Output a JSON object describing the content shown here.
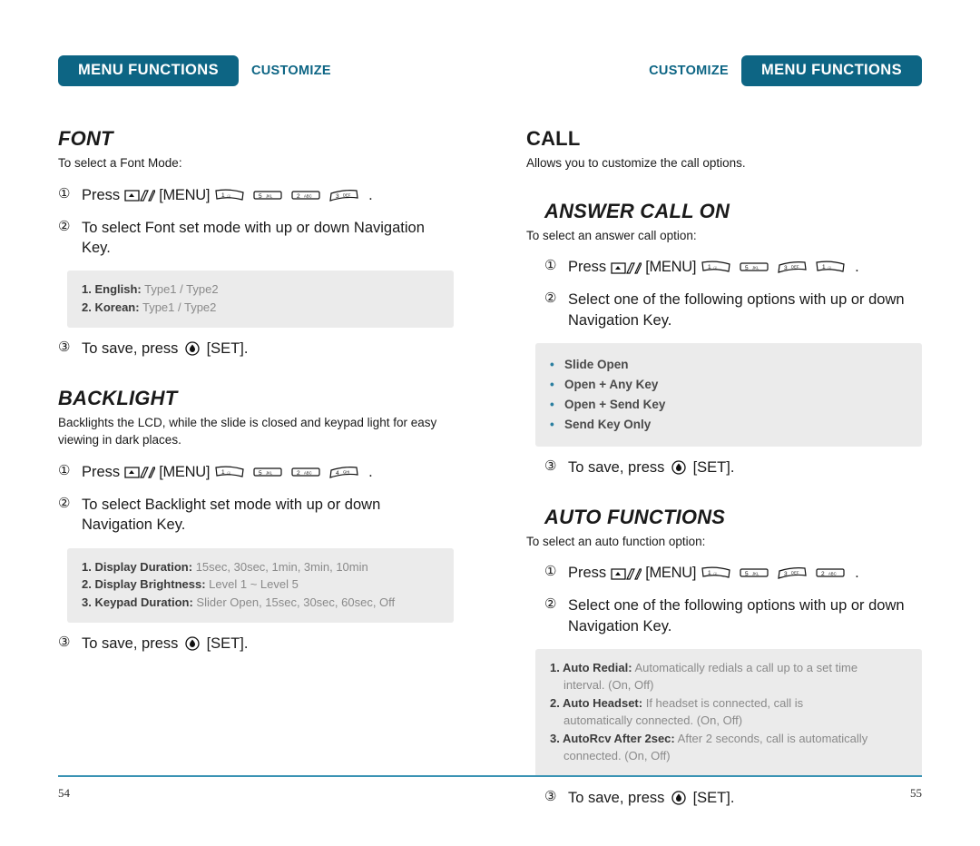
{
  "colors": {
    "banner_teal": "#0d6584",
    "rule_teal": "#3a93b4",
    "bullet_teal": "#2b7fa0",
    "infobox_bg": "#ebebeb"
  },
  "left_page": {
    "banner": "MENU FUNCTIONS",
    "section_tag": "CUSTOMIZE",
    "page_number": "54",
    "sections": [
      {
        "heading": "FONT",
        "lead": "To select a Font Mode:",
        "steps": [
          {
            "num": "①",
            "press_word": "Press",
            "menu_label": "[MENU]",
            "keys": [
              {
                "digit": "1",
                "letters": "☉",
                "shape": "slanted"
              },
              {
                "digit": "5",
                "letters": "JKL",
                "shape": "flat"
              },
              {
                "digit": "2",
                "letters": "ABC",
                "shape": "flat"
              },
              {
                "digit": "3",
                "letters": "DEF",
                "shape": "slanted"
              }
            ],
            "trailing": "."
          },
          {
            "num": "②",
            "text": "To select Font set mode with up or down Navigation Key."
          }
        ],
        "infobox": {
          "type": "numbered",
          "rows": [
            {
              "label": "1. English:",
              "value": "Type1 / Type2"
            },
            {
              "label": "2. Korean:",
              "value": "Type1 / Type2"
            }
          ]
        },
        "save_step": {
          "num": "③",
          "prefix": "To save, press",
          "suffix": "[SET]."
        }
      },
      {
        "heading": "BACKLIGHT",
        "lead": "Backlights the LCD, while the slide is closed and keypad light for easy viewing in dark places.",
        "steps": [
          {
            "num": "①",
            "press_word": "Press",
            "menu_label": "[MENU]",
            "keys": [
              {
                "digit": "1",
                "letters": "☉",
                "shape": "slanted"
              },
              {
                "digit": "5",
                "letters": "JKL",
                "shape": "flat"
              },
              {
                "digit": "2",
                "letters": "ABC",
                "shape": "flat"
              },
              {
                "digit": "4",
                "letters": "GHI",
                "shape": "slanted"
              }
            ],
            "trailing": "."
          },
          {
            "num": "②",
            "text": "To select Backlight set mode with up or down Navigation Key."
          }
        ],
        "infobox": {
          "type": "numbered",
          "rows": [
            {
              "label": "1. Display Duration:",
              "value": "15sec, 30sec, 1min, 3min, 10min"
            },
            {
              "label": "2. Display Brightness:",
              "value": "Level 1 ~ Level 5"
            },
            {
              "label": "3. Keypad Duration:",
              "value": "Slider Open, 15sec, 30sec, 60sec, Off"
            }
          ]
        },
        "save_step": {
          "num": "③",
          "prefix": "To save, press",
          "suffix": "[SET]."
        }
      }
    ]
  },
  "right_page": {
    "banner": "MENU FUNCTIONS",
    "section_tag": "CUSTOMIZE",
    "page_number": "55",
    "top_heading": "CALL",
    "top_lead": "Allows you to customize the call options.",
    "sections": [
      {
        "heading": "ANSWER CALL ON",
        "lead": "To select an answer call option:",
        "steps": [
          {
            "num": "①",
            "press_word": "Press",
            "menu_label": "[MENU]",
            "keys": [
              {
                "digit": "1",
                "letters": "☉",
                "shape": "slanted"
              },
              {
                "digit": "5",
                "letters": "JKL",
                "shape": "flat"
              },
              {
                "digit": "3",
                "letters": "DEF",
                "shape": "slanted"
              },
              {
                "digit": "1",
                "letters": "☉",
                "shape": "slanted"
              }
            ],
            "trailing": "."
          },
          {
            "num": "②",
            "text": "Select one of the following options with up or down Navigation Key."
          }
        ],
        "infobox": {
          "type": "bullets",
          "rows": [
            {
              "label": "Slide Open"
            },
            {
              "label": "Open + Any Key"
            },
            {
              "label": "Open + Send Key"
            },
            {
              "label": "Send Key Only"
            }
          ]
        },
        "save_step": {
          "num": "③",
          "prefix": "To save, press",
          "suffix": "[SET]."
        }
      },
      {
        "heading": "AUTO FUNCTIONS",
        "lead": "To select an auto function option:",
        "steps": [
          {
            "num": "①",
            "press_word": "Press",
            "menu_label": "[MENU]",
            "keys": [
              {
                "digit": "1",
                "letters": "☉",
                "shape": "slanted"
              },
              {
                "digit": "5",
                "letters": "JKL",
                "shape": "flat"
              },
              {
                "digit": "3",
                "letters": "DEF",
                "shape": "slanted"
              },
              {
                "digit": "2",
                "letters": "ABC",
                "shape": "flat"
              }
            ],
            "trailing": "."
          },
          {
            "num": "②",
            "text": "Select one of the following options with up or down Navigation Key."
          }
        ],
        "infobox": {
          "type": "numbered",
          "rows": [
            {
              "label": "1. Auto Redial:",
              "value": "Automatically redials a call up to a set time",
              "cont": "interval. (On, Off)"
            },
            {
              "label": "2. Auto Headset:",
              "value": "If headset is connected, call is",
              "cont": "automatically connected. (On, Off)"
            },
            {
              "label": "3. AutoRcv After 2sec:",
              "value": "After 2 seconds, call is automatically",
              "cont": "connected. (On, Off)"
            }
          ]
        },
        "save_step": {
          "num": "③",
          "prefix": "To save, press",
          "suffix": "[SET]."
        }
      }
    ]
  }
}
